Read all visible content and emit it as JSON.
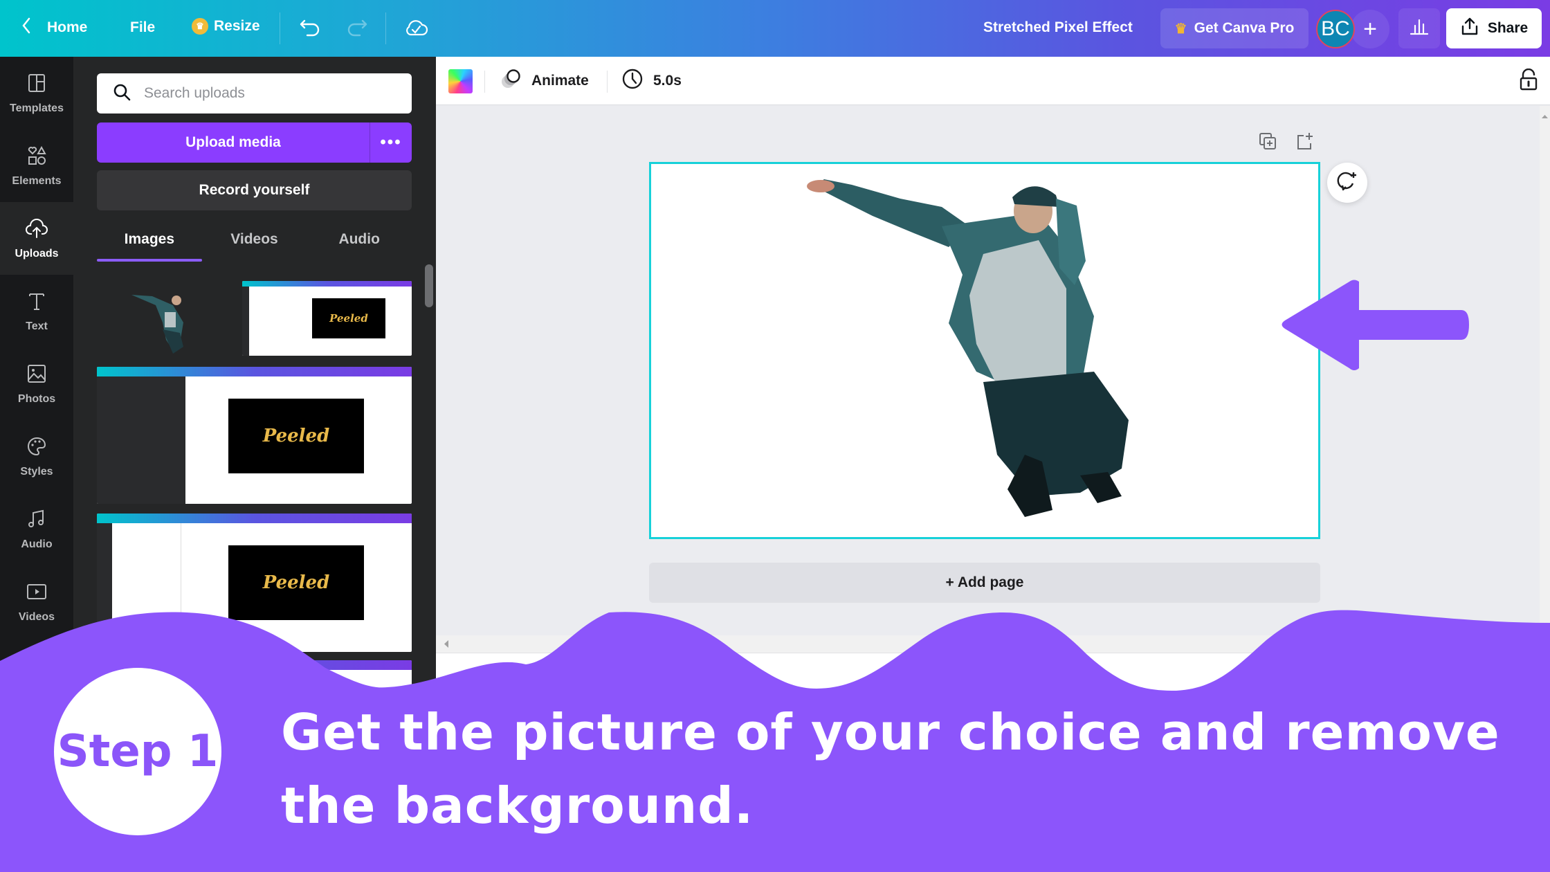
{
  "topbar": {
    "home_label": "Home",
    "file_label": "File",
    "resize_label": "Resize",
    "design_title": "Stretched Pixel Effect",
    "pro_label": "Get Canva Pro",
    "avatar_initials": "BC",
    "add_collaborator": "+",
    "share_label": "Share"
  },
  "rail": {
    "items": [
      {
        "label": "Templates",
        "icon": "templates-icon"
      },
      {
        "label": "Elements",
        "icon": "elements-icon"
      },
      {
        "label": "Uploads",
        "icon": "uploads-icon",
        "active": true
      },
      {
        "label": "Text",
        "icon": "text-icon"
      },
      {
        "label": "Photos",
        "icon": "photos-icon"
      },
      {
        "label": "Styles",
        "icon": "styles-icon"
      },
      {
        "label": "Audio",
        "icon": "audio-icon"
      },
      {
        "label": "Videos",
        "icon": "videos-icon"
      }
    ]
  },
  "panel": {
    "search_placeholder": "Search uploads",
    "upload_label": "Upload media",
    "more_label": "•••",
    "record_label": "Record yourself",
    "tabs": [
      {
        "label": "Images",
        "active": true
      },
      {
        "label": "Videos"
      },
      {
        "label": "Audio"
      }
    ],
    "thumbnails": [
      {
        "kind": "photo",
        "text": ""
      },
      {
        "kind": "screenshot",
        "text": "Peeled"
      },
      {
        "kind": "screenshot",
        "text": "Peeled"
      },
      {
        "kind": "screenshot",
        "text": "Peeled"
      }
    ]
  },
  "toolbar": {
    "animate_label": "Animate",
    "duration_label": "5.0s"
  },
  "canvas": {
    "add_page_label": "+ Add page"
  },
  "overlay": {
    "step_label": "Step 1",
    "instruction": "Get the picture of your choice and remove the background.",
    "accent_color": "#8c55fb"
  }
}
